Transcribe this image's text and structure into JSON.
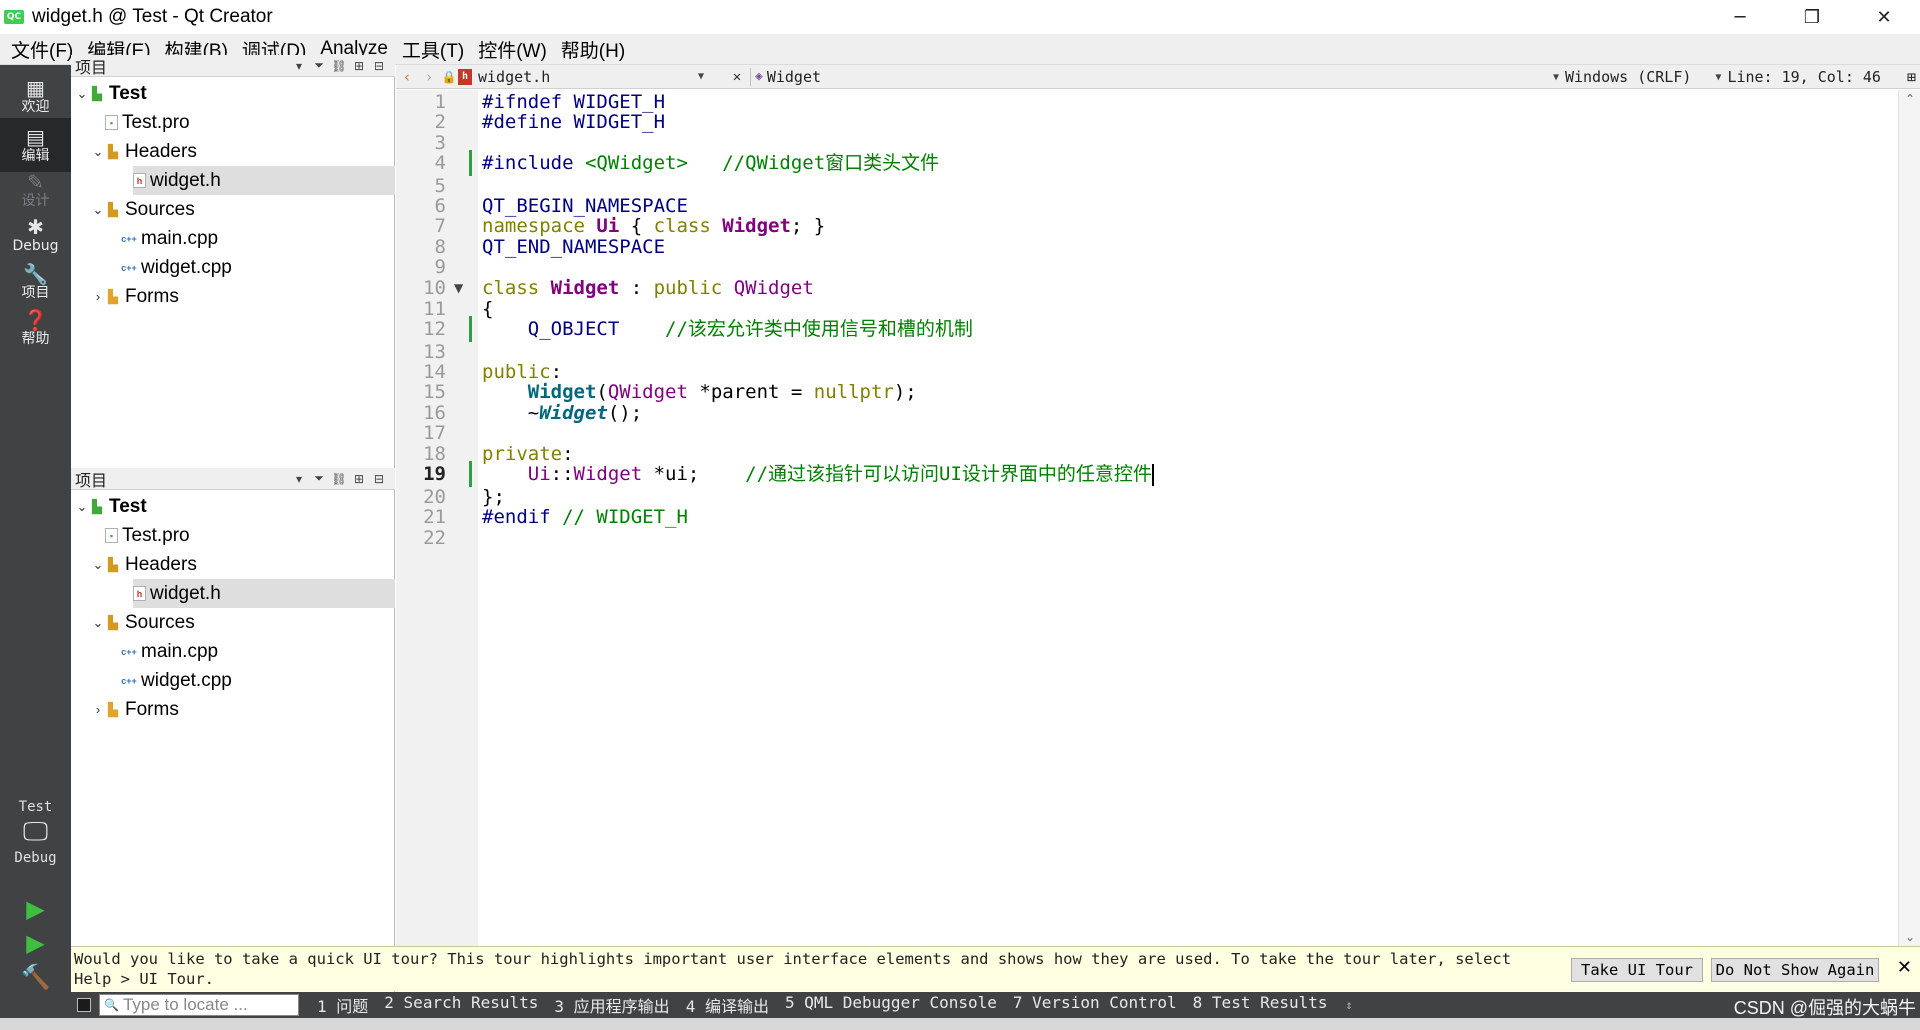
{
  "window": {
    "title": "widget.h @ Test - Qt Creator",
    "app_icon_text": "QC",
    "minimize": "─",
    "maximize": "❐",
    "close": "✕"
  },
  "menu": [
    "文件(F)",
    "编辑(E)",
    "构建(B)",
    "调试(D)",
    "Analyze",
    "工具(T)",
    "控件(W)",
    "帮助(H)"
  ],
  "modes": [
    {
      "label": "欢迎",
      "icon": "grid-icon",
      "glyph": "▦"
    },
    {
      "label": "编辑",
      "icon": "edit-icon",
      "glyph": "▤"
    },
    {
      "label": "设计",
      "icon": "design-pencil-icon",
      "glyph": "✎"
    },
    {
      "label": "Debug",
      "icon": "bug-icon",
      "glyph": "✱"
    },
    {
      "label": "项目",
      "icon": "wrench-icon",
      "glyph": "🔧"
    },
    {
      "label": "帮助",
      "icon": "help-icon",
      "glyph": "❓"
    }
  ],
  "kit": {
    "project": "Test",
    "config": "Debug",
    "monitor_glyph": "🖵"
  },
  "run": {
    "run_glyph": "▶",
    "debug_run_glyph": "▶",
    "build_glyph": "🔨"
  },
  "project_pane": {
    "title": "项目",
    "tools": [
      "▾",
      "⏷",
      "⛓",
      "⊞",
      "⊟"
    ],
    "tree": [
      {
        "label": "Test",
        "level": 0,
        "arrow": "⌄",
        "icon": "proj",
        "glyph": "▙",
        "bold": true,
        "selected": false
      },
      {
        "label": "Test.pro",
        "level": 1,
        "arrow": "",
        "icon": "profile",
        "glyph": "▪",
        "bold": false,
        "selected": false
      },
      {
        "label": "Headers",
        "level": 1,
        "arrow": "⌄",
        "icon": "hdrfolder",
        "glyph": "▙",
        "bold": false,
        "selected": false
      },
      {
        "label": "widget.h",
        "level": 2,
        "arrow": "",
        "icon": "hfile",
        "glyph": "h",
        "bold": false,
        "selected": true
      },
      {
        "label": "Sources",
        "level": 1,
        "arrow": "⌄",
        "icon": "cppfolder",
        "glyph": "▙",
        "bold": false,
        "selected": false
      },
      {
        "label": "main.cpp",
        "level": 2,
        "arrow": "",
        "icon": "cppfile",
        "glyph": "c++",
        "bold": false,
        "selected": false
      },
      {
        "label": "widget.cpp",
        "level": 2,
        "arrow": "",
        "icon": "cppfile",
        "glyph": "c++",
        "bold": false,
        "selected": false
      },
      {
        "label": "Forms",
        "level": 1,
        "arrow": "›",
        "icon": "formfolder",
        "glyph": "▙",
        "bold": false,
        "selected": false
      }
    ]
  },
  "editor_toolbar": {
    "back": "‹",
    "forward": "›",
    "lock": "🔒",
    "file": "widget.h",
    "file_icon": "h",
    "close": "✕",
    "symbol": "Widget",
    "line_ending": "Windows (CRLF)",
    "position": "Line: 19, Col: 46",
    "split": "⊞"
  },
  "editor": {
    "current_line": 19,
    "modified_lines": [
      4,
      12,
      19
    ],
    "fold_lines": [
      10
    ],
    "lines": [
      [
        {
          "t": "#ifndef WIDGET_H",
          "c": "pp"
        }
      ],
      [
        {
          "t": "#define WIDGET_H",
          "c": "pp"
        }
      ],
      [],
      [
        {
          "t": "#include ",
          "c": "pp"
        },
        {
          "t": "<QWidget>",
          "c": "inc"
        },
        {
          "t": "   ",
          "c": ""
        },
        {
          "t": "//QWidget窗口类头文件",
          "c": "cmt"
        }
      ],
      [],
      [
        {
          "t": "QT_BEGIN_NAMESPACE",
          "c": "mac"
        }
      ],
      [
        {
          "t": "namespace ",
          "c": "kw"
        },
        {
          "t": "Ui",
          "c": "ty"
        },
        {
          "t": " { ",
          "c": ""
        },
        {
          "t": "class ",
          "c": "kw"
        },
        {
          "t": "Widget",
          "c": "ty"
        },
        {
          "t": "; }",
          "c": ""
        }
      ],
      [
        {
          "t": "QT_END_NAMESPACE",
          "c": "mac"
        }
      ],
      [],
      [
        {
          "t": "class ",
          "c": "kw"
        },
        {
          "t": "Widget",
          "c": "ty"
        },
        {
          "t": " : ",
          "c": ""
        },
        {
          "t": "public ",
          "c": "kw"
        },
        {
          "t": "QWidget",
          "c": "cls"
        }
      ],
      [
        {
          "t": "{",
          "c": ""
        }
      ],
      [
        {
          "t": "    Q_OBJECT",
          "c": "mac"
        },
        {
          "t": "    ",
          "c": ""
        },
        {
          "t": "//该宏允许类中使用信号和槽的机制",
          "c": "cmt"
        }
      ],
      [],
      [
        {
          "t": "public",
          "c": "kw"
        },
        {
          "t": ":",
          "c": ""
        }
      ],
      [
        {
          "t": "    ",
          "c": ""
        },
        {
          "t": "Widget",
          "c": "fnb"
        },
        {
          "t": "(",
          "c": ""
        },
        {
          "t": "QWidget",
          "c": "cls"
        },
        {
          "t": " *parent = ",
          "c": ""
        },
        {
          "t": "nullptr",
          "c": "kw"
        },
        {
          "t": ");",
          "c": ""
        }
      ],
      [
        {
          "t": "    ~",
          "c": ""
        },
        {
          "t": "Widget",
          "c": "fni"
        },
        {
          "t": "();",
          "c": ""
        }
      ],
      [],
      [
        {
          "t": "private",
          "c": "kw"
        },
        {
          "t": ":",
          "c": ""
        }
      ],
      [
        {
          "t": "    Ui",
          "c": "cls"
        },
        {
          "t": "::",
          "c": ""
        },
        {
          "t": "Widget",
          "c": "cls"
        },
        {
          "t": " *ui;    ",
          "c": ""
        },
        {
          "t": "//通过该指针可以访问UI设计界面中的任意控件",
          "c": "cmt"
        }
      ],
      [
        {
          "t": "};",
          "c": ""
        }
      ],
      [
        {
          "t": "#endif ",
          "c": "pp"
        },
        {
          "t": "// WIDGET_H",
          "c": "cmt"
        }
      ],
      []
    ]
  },
  "scrollbar": {
    "up": "⌃",
    "down": "⌄"
  },
  "info_bar": {
    "message": "Would you like to take a quick UI tour? This tour highlights important user interface elements and shows how they are used. To take the tour later, select Help > UI Tour.",
    "take_tour": "Take UI Tour",
    "dont_show": "Do Not Show Again",
    "close": "✕"
  },
  "output_bar": {
    "locate_placeholder": "Type to locate ...",
    "locate_icon": "🔍",
    "tabs": [
      "1 问题",
      "2 Search Results",
      "3 应用程序输出",
      "4 编译输出",
      "5 QML Debugger Console",
      "7 Version Control",
      "8 Test Results"
    ],
    "arrows": "⇕",
    "watermark": "CSDN @倔强的大蜗牛"
  }
}
